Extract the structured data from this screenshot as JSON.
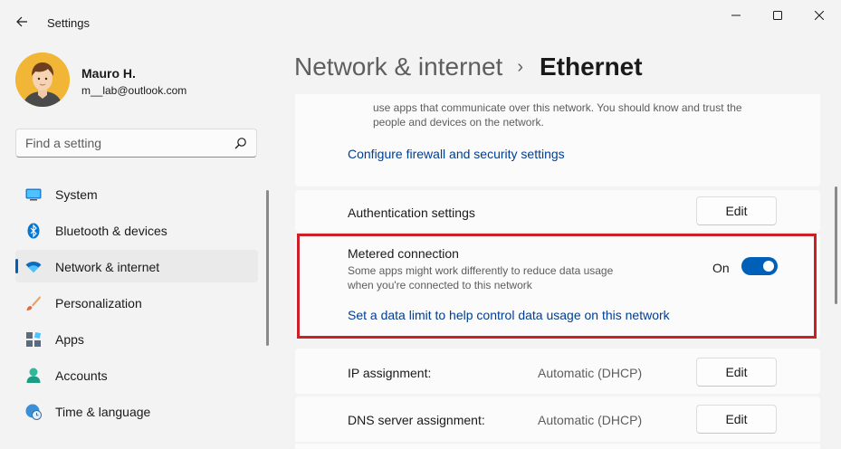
{
  "window": {
    "title": "Settings",
    "controls": [
      "minimize",
      "maximize",
      "close"
    ]
  },
  "profile": {
    "name": "Mauro H.",
    "email": "m__lab@outlook.com"
  },
  "search": {
    "placeholder": "Find a setting",
    "value": ""
  },
  "sidebar": {
    "items": [
      {
        "label": "System",
        "icon": "monitor-icon",
        "active": false
      },
      {
        "label": "Bluetooth & devices",
        "icon": "bluetooth-icon",
        "active": false
      },
      {
        "label": "Network & internet",
        "icon": "wifi-icon",
        "active": true
      },
      {
        "label": "Personalization",
        "icon": "paintbrush-icon",
        "active": false
      },
      {
        "label": "Apps",
        "icon": "apps-icon",
        "active": false
      },
      {
        "label": "Accounts",
        "icon": "person-icon",
        "active": false
      },
      {
        "label": "Time & language",
        "icon": "globe-clock-icon",
        "active": false
      }
    ]
  },
  "breadcrumb": {
    "parent": "Network & internet",
    "separator": "›",
    "current": "Ethernet"
  },
  "firewall": {
    "description": "use apps that communicate over this network. You should know and trust the people and devices on the network.",
    "link": "Configure firewall and security settings"
  },
  "authentication": {
    "label": "Authentication settings",
    "button": "Edit"
  },
  "metered": {
    "title": "Metered connection",
    "description": "Some apps might work differently to reduce data usage when you're connected to this network",
    "toggle_state": "On",
    "toggle_on": true,
    "link": "Set a data limit to help control data usage on this network"
  },
  "ip_assignment": {
    "label": "IP assignment:",
    "value": "Automatic (DHCP)",
    "button": "Edit"
  },
  "dns_assignment": {
    "label": "DNS server assignment:",
    "value": "Automatic (DHCP)",
    "button": "Edit"
  },
  "colors": {
    "accent": "#005fb8",
    "link": "#003e92",
    "highlight": "#cc1f27",
    "background": "#f3f3f3",
    "card": "#fbfbfb"
  }
}
